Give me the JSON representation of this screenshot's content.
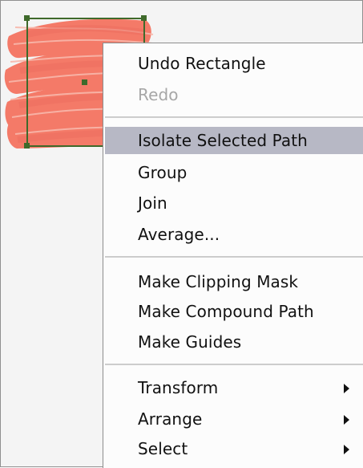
{
  "context_menu": {
    "items": [
      {
        "label": "Undo Rectangle",
        "enabled": true,
        "highlighted": false,
        "submenu": false
      },
      {
        "label": "Redo",
        "enabled": false,
        "highlighted": false,
        "submenu": false
      },
      {
        "label": "Isolate Selected Path",
        "enabled": true,
        "highlighted": true,
        "submenu": false
      },
      {
        "label": "Group",
        "enabled": true,
        "highlighted": false,
        "submenu": false
      },
      {
        "label": "Join",
        "enabled": true,
        "highlighted": false,
        "submenu": false
      },
      {
        "label": "Average...",
        "enabled": true,
        "highlighted": false,
        "submenu": false
      },
      {
        "label": "Make Clipping Mask",
        "enabled": true,
        "highlighted": false,
        "submenu": false
      },
      {
        "label": "Make Compound Path",
        "enabled": true,
        "highlighted": false,
        "submenu": false
      },
      {
        "label": "Make Guides",
        "enabled": true,
        "highlighted": false,
        "submenu": false
      },
      {
        "label": "Transform",
        "enabled": true,
        "highlighted": false,
        "submenu": true
      },
      {
        "label": "Arrange",
        "enabled": true,
        "highlighted": false,
        "submenu": true
      },
      {
        "label": "Select",
        "enabled": true,
        "highlighted": false,
        "submenu": true
      }
    ]
  },
  "artwork": {
    "fill_color": "#f47a68",
    "selection_color": "#3f6a2b"
  },
  "icons": {
    "submenu_arrow": "submenu-arrow-icon",
    "anchor_point": "anchor-point-icon"
  }
}
